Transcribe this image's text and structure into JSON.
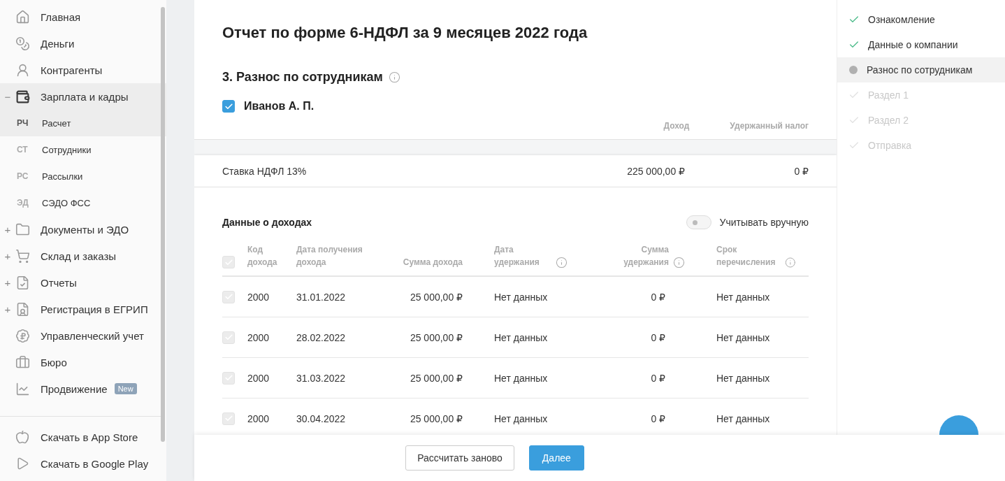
{
  "sidebar": {
    "items": [
      {
        "kind": "main",
        "label": "Главная",
        "selected": false
      },
      {
        "kind": "main",
        "label": "Деньги",
        "selected": false
      },
      {
        "kind": "main",
        "label": "Контрагенты",
        "selected": false
      },
      {
        "kind": "main",
        "label": "Зарплата и кадры",
        "selected": true,
        "sign": "−"
      },
      {
        "kind": "sub",
        "code": "РЧ",
        "label": "Расчет",
        "selected": true
      },
      {
        "kind": "sub",
        "code": "СТ",
        "label": "Сотрудники",
        "selected": false
      },
      {
        "kind": "sub",
        "code": "РС",
        "label": "Рассылки",
        "selected": false
      },
      {
        "kind": "sub",
        "code": "ЭД",
        "label": "СЭДО ФСС",
        "selected": false
      },
      {
        "kind": "main",
        "label": "Документы и ЭДО",
        "selected": false,
        "sign": "+"
      },
      {
        "kind": "main",
        "label": "Склад и заказы",
        "selected": false,
        "sign": "+"
      },
      {
        "kind": "main",
        "label": "Отчеты",
        "selected": false,
        "sign": "+"
      },
      {
        "kind": "main",
        "label": "Регистрация в ЕГРИП",
        "selected": false,
        "sign": "+"
      },
      {
        "kind": "main",
        "label": "Управленческий учет",
        "selected": false
      },
      {
        "kind": "main",
        "label": "Бюро",
        "selected": false
      },
      {
        "kind": "main",
        "label": "Продвижение",
        "selected": false,
        "badge": "New"
      }
    ],
    "downloads": [
      "Скачать в App Store",
      "Скачать в Google Play"
    ]
  },
  "report": {
    "title": "Отчет по форме 6-НДФЛ за 9 месяцев 2022 года",
    "section": "3. Разнос по сотрудникам",
    "employee": {
      "name": "Иванов А. П.",
      "checked": true
    },
    "summary_columns": [
      "Доход",
      "Удержанный налог"
    ],
    "summary_row": {
      "label": "Ставка НДФЛ 13%",
      "income": "225 000,00 ₽",
      "tax": "0 ₽"
    },
    "income": {
      "title": "Данные о доходах",
      "toggle": {
        "label": "Учитывать вручную",
        "on": false
      },
      "header_checked": true,
      "columns": [
        {
          "label": "Код дохода",
          "info": false
        },
        {
          "label": "Дата получения дохода",
          "info": false
        },
        {
          "label": "Сумма дохода",
          "info": false
        },
        {
          "label": "Дата удержания",
          "info": true
        },
        {
          "label": "Сумма удержания",
          "info": true
        },
        {
          "label": "Срок перечисления",
          "info": true
        }
      ],
      "rows": [
        {
          "checked": true,
          "cells": [
            "2000",
            "31.01.2022",
            "25 000,00 ₽",
            "Нет данных",
            "0 ₽",
            "Нет данных"
          ]
        },
        {
          "checked": true,
          "cells": [
            "2000",
            "28.02.2022",
            "25 000,00 ₽",
            "Нет данных",
            "0 ₽",
            "Нет данных"
          ]
        },
        {
          "checked": true,
          "cells": [
            "2000",
            "31.03.2022",
            "25 000,00 ₽",
            "Нет данных",
            "0 ₽",
            "Нет данных"
          ]
        },
        {
          "checked": true,
          "cells": [
            "2000",
            "30.04.2022",
            "25 000,00 ₽",
            "Нет данных",
            "0 ₽",
            "Нет данных"
          ]
        }
      ]
    }
  },
  "steps": [
    {
      "label": "Ознакомление",
      "kind": "done"
    },
    {
      "label": "Данные о компании",
      "kind": "done"
    },
    {
      "label": "Разнос по сотрудникам",
      "kind": "current"
    },
    {
      "label": "Раздел 1",
      "kind": "pending"
    },
    {
      "label": "Раздел 2",
      "kind": "pending"
    },
    {
      "label": "Отправка",
      "kind": "pending"
    }
  ],
  "footer": {
    "buttons": [
      {
        "label": "Рассчитать заново",
        "kind": "secondary"
      },
      {
        "label": "Далее",
        "kind": "primary"
      }
    ]
  }
}
